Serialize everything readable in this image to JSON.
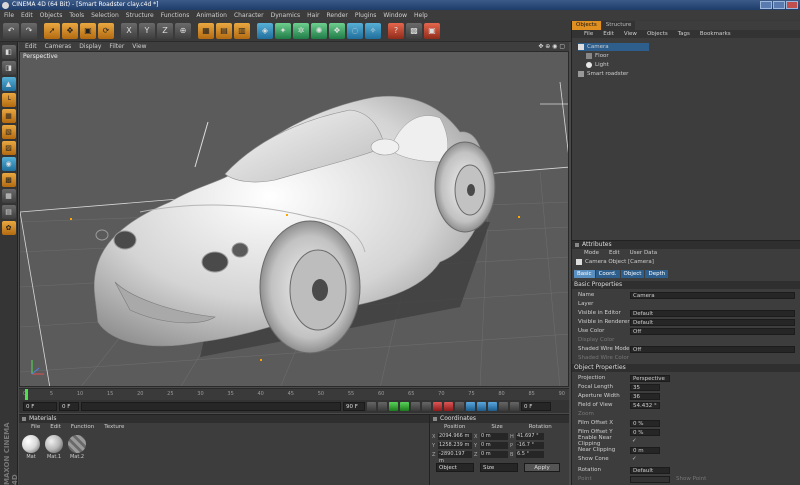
{
  "window": {
    "title": "CINEMA 4D (64 Bit) - [Smart Roadster clay.c4d *]"
  },
  "menubar": [
    "File",
    "Edit",
    "Objects",
    "Tools",
    "Selection",
    "Structure",
    "Functions",
    "Animation",
    "Character",
    "Dynamics",
    "Hair",
    "Render",
    "Plugins",
    "Window",
    "Help"
  ],
  "viewport": {
    "menu": [
      "Edit",
      "Cameras",
      "Display",
      "Filter",
      "View"
    ],
    "label": "Perspective"
  },
  "timeline": {
    "ticks": [
      "0",
      "5",
      "10",
      "15",
      "20",
      "25",
      "30",
      "35",
      "40",
      "45",
      "50",
      "55",
      "60",
      "65",
      "70",
      "75",
      "80",
      "85",
      "90"
    ],
    "start": "0 F",
    "current": "0 F",
    "end": "90 F",
    "frame_right": "0 F"
  },
  "materials": {
    "title": "Materials",
    "menu": [
      "File",
      "Edit",
      "Function",
      "Texture"
    ],
    "items": [
      {
        "name": "Mat",
        "color": "#d8d8d8"
      },
      {
        "name": "Mat.1",
        "color": "#b7b7b7"
      },
      {
        "name": "Mat.2",
        "color": "#8a8a8a"
      }
    ]
  },
  "coordinates": {
    "title": "Coordinates",
    "headers": [
      "Position",
      "Size",
      "Rotation"
    ],
    "rows": [
      {
        "axis": "X",
        "pos": "2094.966 m",
        "size": "0 m",
        "rot_axis": "H",
        "rot": "41.697 °"
      },
      {
        "axis": "Y",
        "pos": "1258.239 m",
        "size": "0 m",
        "rot_axis": "P",
        "rot": "-16.7 °"
      },
      {
        "axis": "Z",
        "pos": "-2890.197 m",
        "size": "0 m",
        "rot_axis": "B",
        "rot": "6.5 °"
      }
    ],
    "mode_object": "Object",
    "mode_size": "Size",
    "apply": "Apply"
  },
  "objects": {
    "tabs": [
      "Objects",
      "Structure"
    ],
    "menu": [
      "File",
      "Edit",
      "View",
      "Objects",
      "Tags",
      "Bookmarks"
    ],
    "items": [
      {
        "name": "Camera",
        "selected": true,
        "indent": 0
      },
      {
        "name": "Floor",
        "selected": false,
        "indent": 1
      },
      {
        "name": "Light",
        "selected": false,
        "indent": 1
      },
      {
        "name": "Smart roadster",
        "selected": false,
        "indent": 0
      }
    ]
  },
  "attributes": {
    "title": "Attributes",
    "menu": [
      "Mode",
      "Edit",
      "User Data"
    ],
    "object_label": "Camera Object [Camera]",
    "tabs": [
      "Basic",
      "Coord.",
      "Object",
      "Depth"
    ],
    "basic": {
      "header": "Basic Properties",
      "rows": [
        {
          "label": "Name",
          "value": "Camera"
        },
        {
          "label": "Layer",
          "value": ""
        },
        {
          "label": "Visible in Editor",
          "value": "Default"
        },
        {
          "label": "Visible in Renderer",
          "value": "Default"
        },
        {
          "label": "Use Color",
          "value": "Off"
        },
        {
          "label": "Display Color",
          "value": ""
        },
        {
          "label": "Shaded Wire Mode",
          "value": "Off"
        },
        {
          "label": "Shaded Wire Color",
          "value": ""
        }
      ]
    },
    "object": {
      "header": "Object Properties",
      "rows": [
        {
          "label": "Projection",
          "value": "Perspective"
        },
        {
          "label": "Focal Length",
          "value": "35"
        },
        {
          "label": "Aperture Width",
          "value": "36"
        },
        {
          "label": "Field of View",
          "value": "54.432 °"
        },
        {
          "label": "Zoom",
          "value": ""
        },
        {
          "label": "Film Offset X",
          "value": "0 %"
        },
        {
          "label": "Film Offset Y",
          "value": "0 %"
        },
        {
          "label": "Enable Near Clipping",
          "value": "✓"
        },
        {
          "label": "Near Clipping",
          "value": "0 m"
        },
        {
          "label": "Show Cone",
          "value": "✓"
        },
        {
          "label": "Rotation",
          "value": "Default"
        },
        {
          "label": "Point",
          "value": ""
        }
      ]
    },
    "show_point": "Show Point"
  },
  "brand": "MAXON CINEMA 4D",
  "colors": {
    "accent": "#e09020",
    "selection": "#2d5e8c"
  }
}
